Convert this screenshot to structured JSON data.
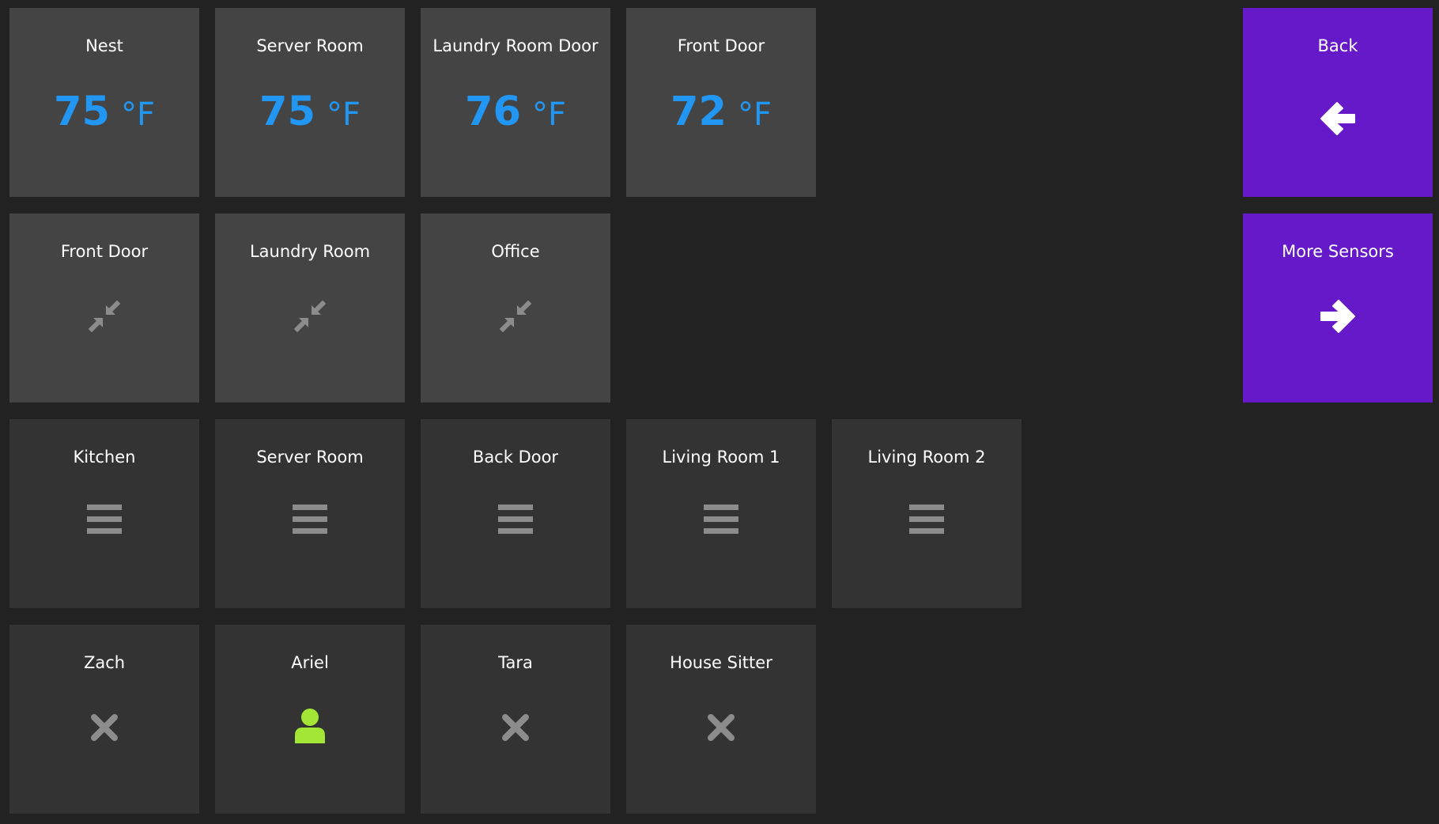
{
  "colors": {
    "background": "#222222",
    "tile_light": "#444444",
    "tile_dark": "#333333",
    "accent_purple": "#6619c9",
    "temperature_blue": "#2196f3",
    "icon_gray": "#8c8c8c",
    "presence_green": "#a3e635"
  },
  "temperature_tiles": [
    {
      "title": "Nest",
      "value": "75",
      "unit": "°F"
    },
    {
      "title": "Server Room",
      "value": "75",
      "unit": "°F"
    },
    {
      "title": "Laundry Room Door",
      "value": "76",
      "unit": "°F"
    },
    {
      "title": "Front Door",
      "value": "72",
      "unit": "°F"
    }
  ],
  "contact_tiles": [
    {
      "title": "Front Door",
      "icon": "compress-closed-icon"
    },
    {
      "title": "Laundry Room",
      "icon": "compress-closed-icon"
    },
    {
      "title": "Office",
      "icon": "compress-closed-icon"
    }
  ],
  "motion_tiles": [
    {
      "title": "Kitchen",
      "icon": "bars-icon"
    },
    {
      "title": "Server Room",
      "icon": "bars-icon"
    },
    {
      "title": "Back Door",
      "icon": "bars-icon"
    },
    {
      "title": "Living Room 1",
      "icon": "bars-icon"
    },
    {
      "title": "Living Room 2",
      "icon": "bars-icon"
    }
  ],
  "presence_tiles": [
    {
      "title": "Zach",
      "icon": "x-icon",
      "present": false
    },
    {
      "title": "Ariel",
      "icon": "person-icon",
      "present": true
    },
    {
      "title": "Tara",
      "icon": "x-icon",
      "present": false
    },
    {
      "title": "House Sitter",
      "icon": "x-icon",
      "present": false
    }
  ],
  "nav": {
    "back_label": "Back",
    "back_icon": "arrow-left-icon",
    "more_label": "More Sensors",
    "more_icon": "arrow-right-icon"
  }
}
